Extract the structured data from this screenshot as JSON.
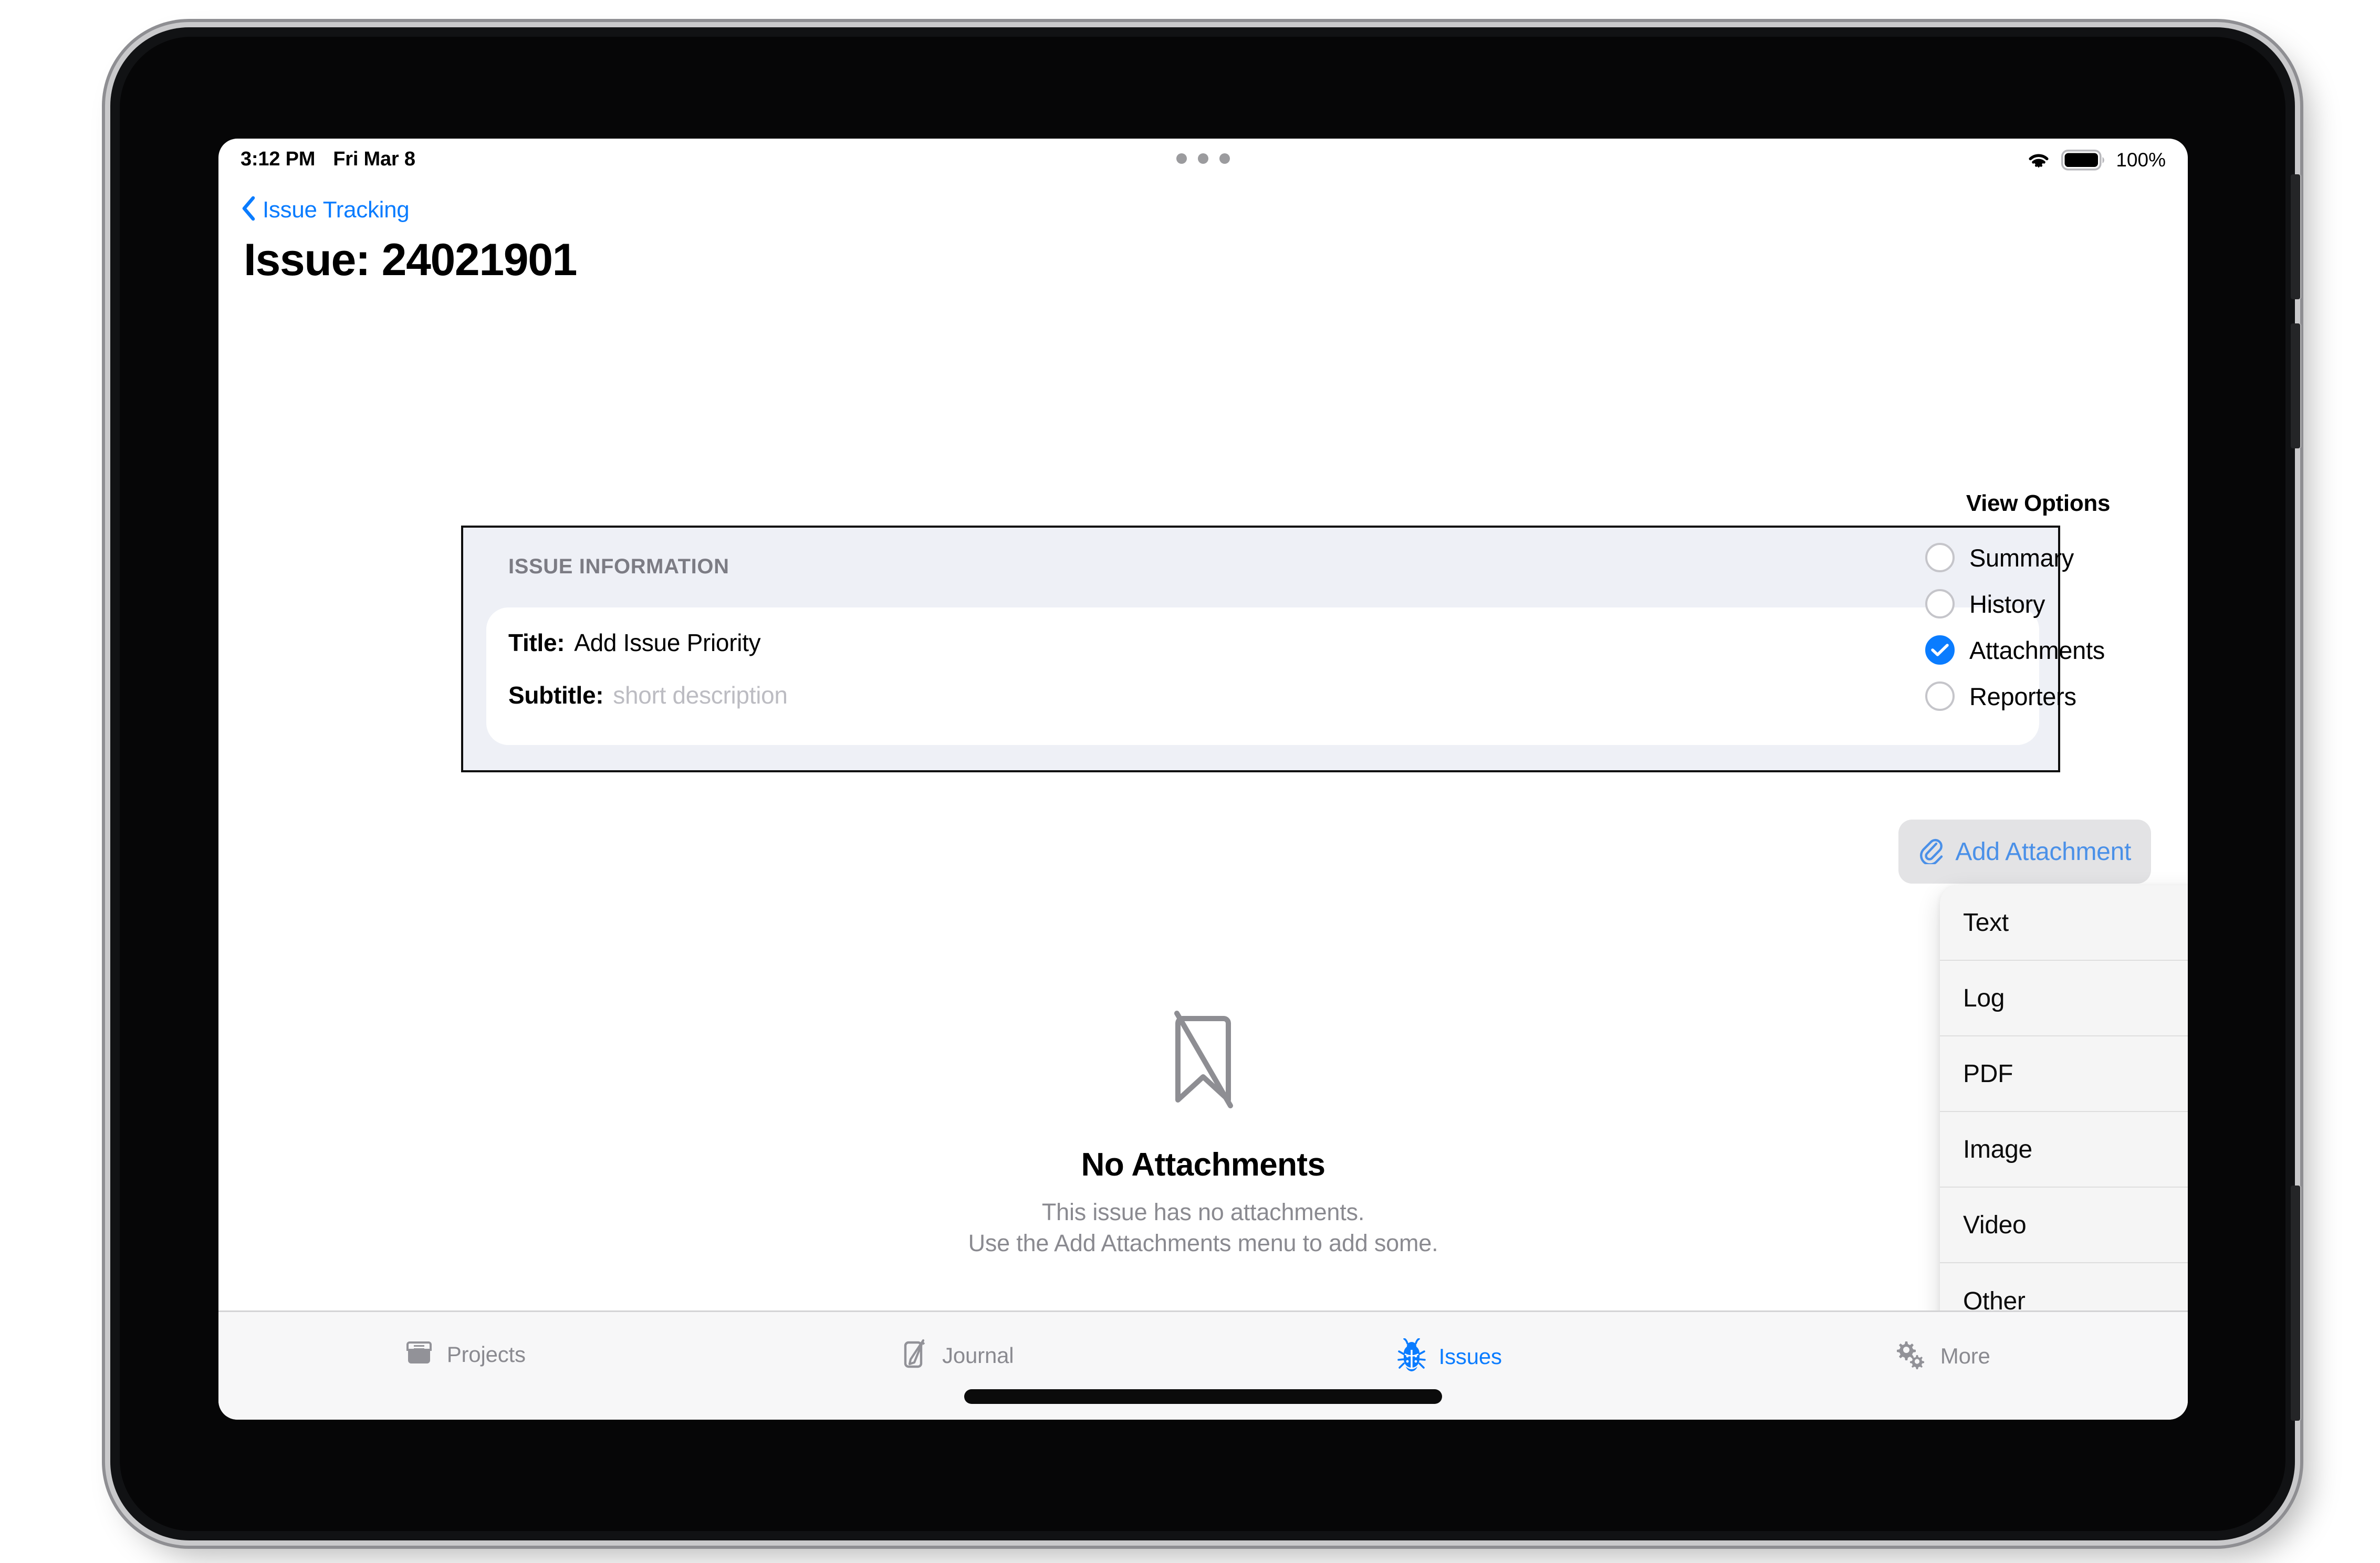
{
  "status_bar": {
    "time": "3:12 PM",
    "date": "Fri Mar 8",
    "battery_percent": "100%",
    "wifi_icon": "wifi-icon",
    "battery_icon": "battery-full-icon",
    "multitask_icon": "multitask-dots-icon"
  },
  "nav": {
    "back_label": "Issue Tracking",
    "back_icon": "chevron-left-icon"
  },
  "page": {
    "title": "Issue: 24021901"
  },
  "issue_info": {
    "section_header": "ISSUE INFORMATION",
    "title_label": "Title:",
    "title_value": "Add Issue Priority",
    "subtitle_label": "Subtitle:",
    "subtitle_placeholder": "short description"
  },
  "view_options": {
    "title": "View Options",
    "items": [
      {
        "label": "Summary",
        "selected": false
      },
      {
        "label": "History",
        "selected": false
      },
      {
        "label": "Attachments",
        "selected": true
      },
      {
        "label": "Reporters",
        "selected": false
      }
    ]
  },
  "add_attachment": {
    "label": "Add Attachment",
    "icon": "paperclip-icon"
  },
  "attachment_menu": {
    "items": [
      {
        "label": "Text",
        "icon": "text-quote-icon"
      },
      {
        "label": "Log",
        "icon": "document-lines-icon"
      },
      {
        "label": "PDF",
        "icon": "pdf-doc-icon"
      },
      {
        "label": "Image",
        "icon": "photo-icon"
      },
      {
        "label": "Video",
        "icon": "clapperboard-icon"
      },
      {
        "label": "Other",
        "icon": "paperclip-icon"
      }
    ]
  },
  "empty_state": {
    "icon": "bookmark-slash-icon",
    "title": "No Attachments",
    "line1": "This issue has no attachments.",
    "line2": "Use the Add Attachments menu to add some."
  },
  "tab_bar": {
    "items": [
      {
        "label": "Projects",
        "icon": "tray-icon",
        "active": false
      },
      {
        "label": "Journal",
        "icon": "compose-icon",
        "active": false
      },
      {
        "label": "Issues",
        "icon": "bug-icon",
        "active": true
      },
      {
        "label": "More",
        "icon": "gears-icon",
        "active": false
      }
    ]
  },
  "colors": {
    "accent": "#0a7cff",
    "card_fill": "#eef0f6",
    "menu_fill": "#f5f5f5",
    "muted_text": "#8a8a90"
  }
}
